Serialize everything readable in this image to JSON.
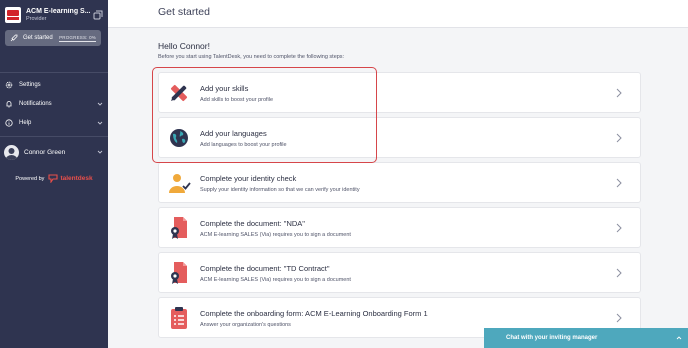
{
  "org": {
    "name": "ACM E-learning S...",
    "role": "Provider"
  },
  "sidebar": {
    "get_started": {
      "label": "Get started",
      "progress": "PROGRESS: 0%"
    },
    "items": [
      {
        "label": "Settings"
      },
      {
        "label": "Notifications"
      },
      {
        "label": "Help"
      }
    ],
    "user": {
      "name": "Connor Green"
    },
    "powered_by": "Powered by",
    "brand": "talentdesk"
  },
  "header": {
    "title": "Get started"
  },
  "main": {
    "greeting": "Hello Connor!",
    "intro": "Before you start using TalentDesk, you need to complete the following steps:",
    "steps": [
      {
        "title": "Add your skills",
        "description": "Add skills to boost your profile",
        "icon": "pencil-ruler-icon"
      },
      {
        "title": "Add your languages",
        "description": "Add languages to boost your profile",
        "icon": "globe-icon"
      },
      {
        "title": "Complete your identity check",
        "description": "Supply your identity information so that we can verify your identity",
        "icon": "identity-check-icon"
      },
      {
        "title": "Complete the document: \"NDA\"",
        "description": "ACM E-learning SALES (Via) requires you to sign a document",
        "icon": "document-certificate-icon"
      },
      {
        "title": "Complete the document: \"TD Contract\"",
        "description": "ACM E-learning SALES (Via) requires you to sign a document",
        "icon": "document-certificate-icon"
      },
      {
        "title": "Complete the onboarding form: ACM E-Learning Onboarding Form 1",
        "description": "Answer your organization's questions",
        "icon": "clipboard-form-icon"
      }
    ]
  },
  "chat": {
    "label": "Chat with your inviting manager"
  },
  "colors": {
    "sidebar": "#2f3450",
    "accent": "#ea4f4a",
    "highlight": "#d6464a",
    "chat": "#4ea8bd"
  }
}
